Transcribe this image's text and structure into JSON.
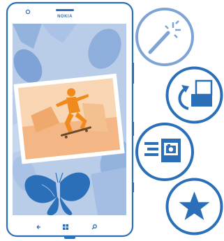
{
  "phone": {
    "brand": "NOKIA",
    "frame_color": "#2b6fb8",
    "screen_colors": {
      "background": "#c9d9ef",
      "photo_bg": "#f7c79a",
      "skater": "#f08a1c"
    },
    "nav_buttons": [
      {
        "name": "back-icon"
      },
      {
        "name": "windows-start-icon"
      },
      {
        "name": "search-icon"
      }
    ]
  },
  "features": [
    {
      "name": "magic-wand-icon",
      "style": "light",
      "color": "#7ea4d6"
    },
    {
      "name": "rotate-crop-icon",
      "style": "medium",
      "color": "#2b6fb8"
    },
    {
      "name": "share-photo-icon",
      "style": "dark",
      "color": "#2b6fb8"
    },
    {
      "name": "favorite-star-icon",
      "style": "dark",
      "color": "#2b6fb8"
    }
  ]
}
